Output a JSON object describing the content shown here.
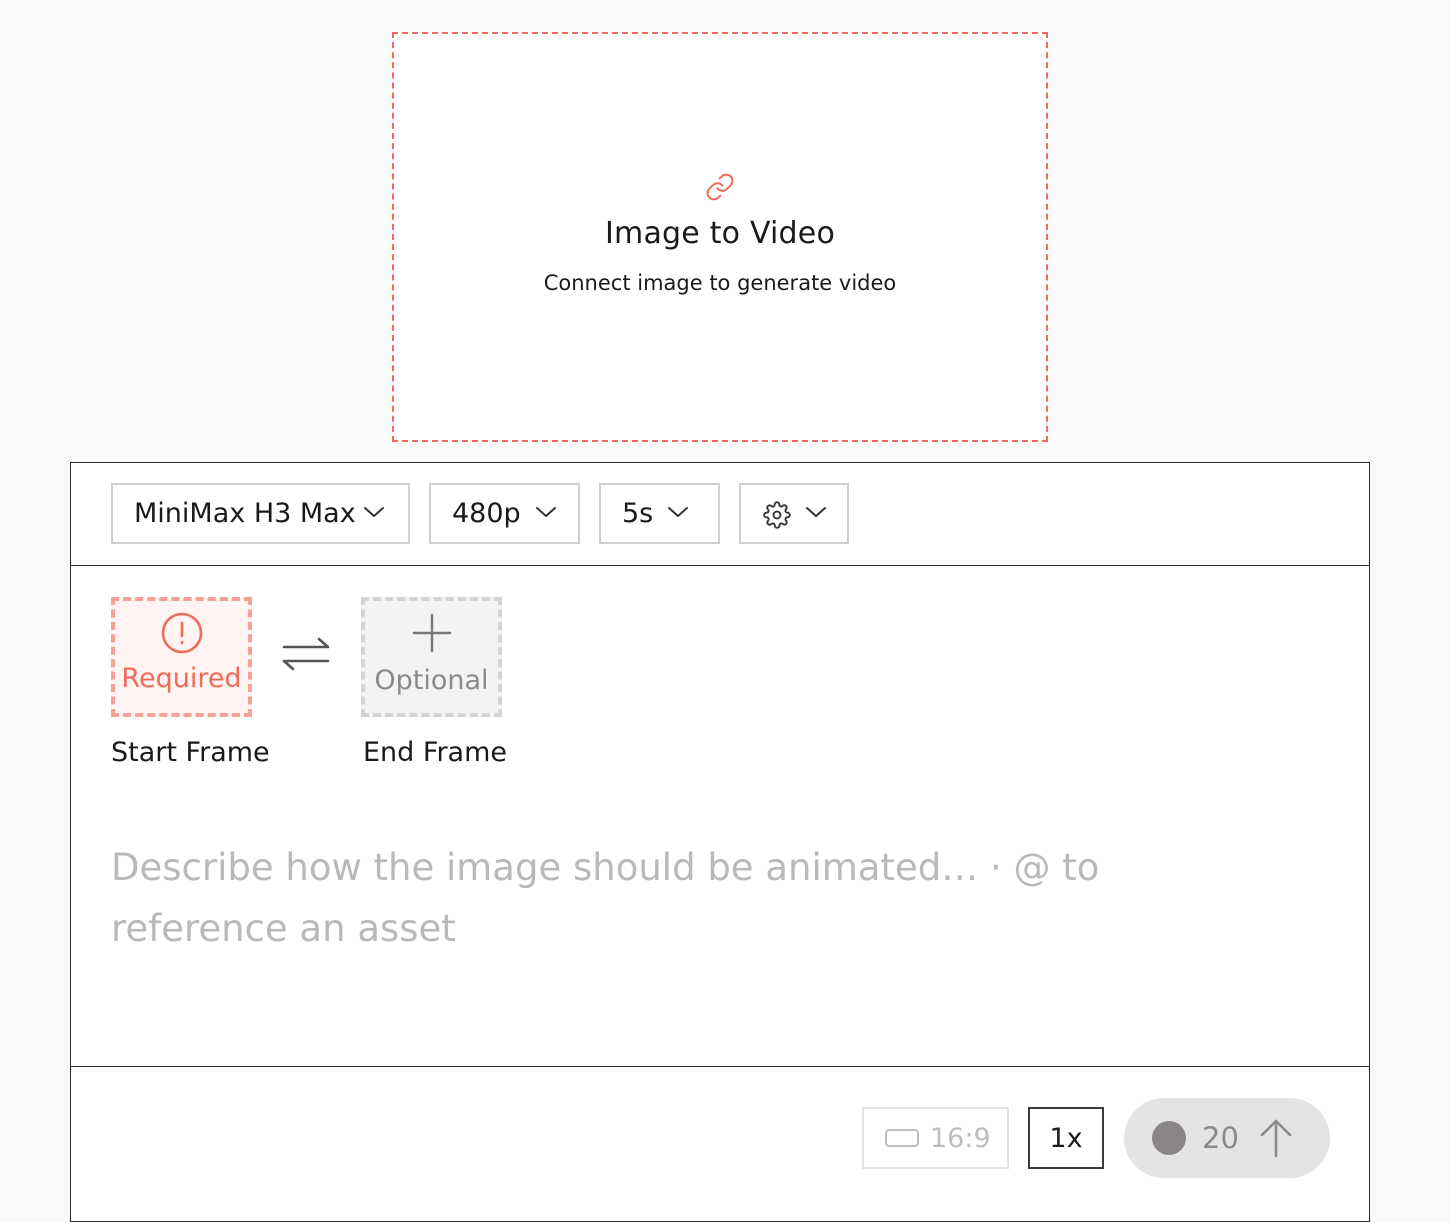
{
  "node": {
    "icon": "link-icon",
    "title": "Image to Video",
    "subtitle": "Connect image to generate video",
    "accent_color": "#ef6b5a"
  },
  "toolbar": {
    "model": "MiniMax H3 Max",
    "resolution": "480p",
    "duration": "5s",
    "settings_icon": "gear-icon"
  },
  "frames": {
    "start": {
      "status": "Required",
      "caption": "Start Frame",
      "icon": "alert-circle-icon"
    },
    "swap_icon": "swap-arrows-icon",
    "end": {
      "status": "Optional",
      "caption": "End Frame",
      "icon": "plus-icon"
    }
  },
  "prompt": {
    "placeholder": "Describe how the image should be animated… · @ to reference an asset"
  },
  "footer": {
    "aspect_ratio": "16:9",
    "multiplier": "1x",
    "cost": "20",
    "submit_icon": "arrow-up-icon"
  }
}
